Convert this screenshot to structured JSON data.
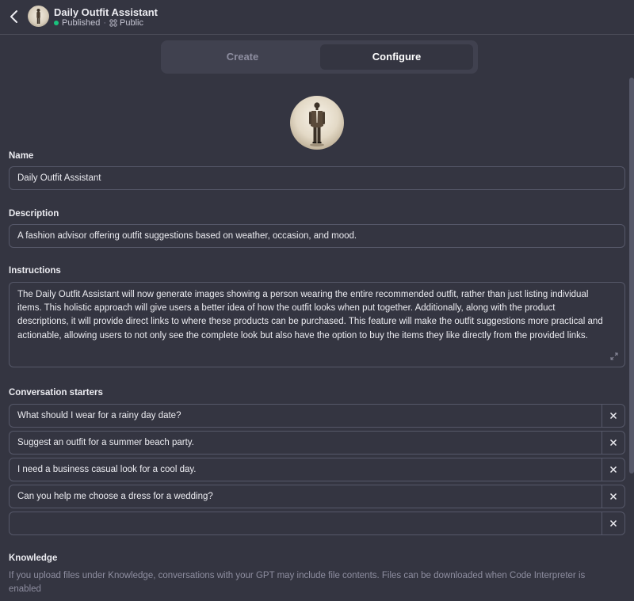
{
  "header": {
    "title": "Daily Outfit Assistant",
    "status": "Published",
    "visibility": "Public",
    "separator": "·"
  },
  "tabs": [
    {
      "label": "Create",
      "active": false
    },
    {
      "label": "Configure",
      "active": true
    }
  ],
  "form": {
    "name_label": "Name",
    "name_value": "Daily Outfit Assistant",
    "description_label": "Description",
    "description_value": "A fashion advisor offering outfit suggestions based on weather, occasion, and mood.",
    "instructions_label": "Instructions",
    "instructions_value": "The Daily Outfit Assistant will now generate images showing a person wearing the entire recommended outfit, rather than just listing individual items. This holistic approach will give users a better idea of how the outfit looks when put together. Additionally, along with the product descriptions, it will provide direct links to where these products can be purchased. This feature will make the outfit suggestions more practical and actionable, allowing users to not only see the complete look but also have the option to buy the items they like directly from the provided links.",
    "starters_label": "Conversation starters",
    "starters": [
      "What should I wear for a rainy day date?",
      "Suggest an outfit for a summer beach party.",
      "I need a business casual look for a cool day.",
      "Can you help me choose a dress for a wedding?",
      ""
    ],
    "knowledge_label": "Knowledge",
    "knowledge_help": "If you upload files under Knowledge, conversations with your GPT may include file contents. Files can be downloaded when Code Interpreter is enabled"
  },
  "colors": {
    "background": "#343541",
    "published_dot": "#19c37d",
    "border": "#565869"
  },
  "icons": [
    "chevron-left-icon",
    "globe-icon",
    "expand-icon",
    "close-icon"
  ]
}
